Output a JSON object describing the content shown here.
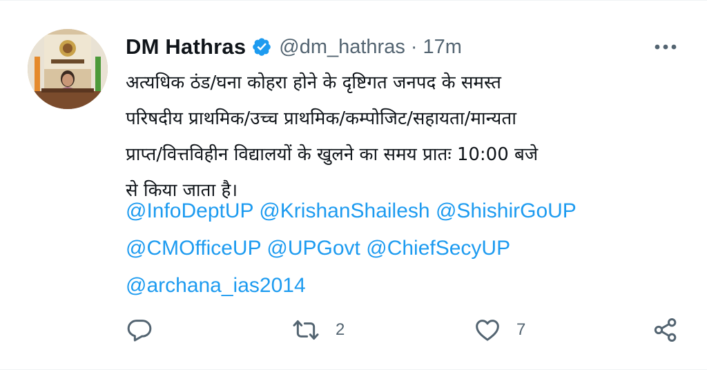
{
  "tweet": {
    "author": {
      "display_name": "DM Hathras",
      "handle": "@dm_hathras",
      "verified": true,
      "avatar_icon": "official-avatar"
    },
    "separator": "·",
    "time": "17m",
    "more_icon": "more-options-icon",
    "text_lines": [
      "अत्यधिक ठंड/घना कोहरा होने के दृष्टिगत जनपद के समस्त",
      "परिषदीय प्राथमिक/उच्च प्राथमिक/कम्पोजिट/सहायता/मान्यता",
      "प्राप्त/वित्तविहीन विद्यालयों के खुलने का समय प्रातः 10:00 बजे",
      "से किया जाता है।"
    ],
    "mentions": [
      [
        "@InfoDeptUP",
        "@KrishanShailesh",
        "@ShishirGoUP"
      ],
      [
        "@CMOfficeUP",
        "@UPGovt",
        "@ChiefSecyUP"
      ],
      [
        "@archana_ias2014"
      ]
    ],
    "actions": {
      "reply": {
        "icon": "reply-icon",
        "count": ""
      },
      "retweet": {
        "icon": "retweet-icon",
        "count": "2"
      },
      "like": {
        "icon": "like-icon",
        "count": "7"
      },
      "share": {
        "icon": "share-icon",
        "count": ""
      }
    }
  },
  "colors": {
    "link": "#1d9bf0",
    "verified": "#1d9bf0",
    "muted": "#536471",
    "text": "#0f1419"
  }
}
